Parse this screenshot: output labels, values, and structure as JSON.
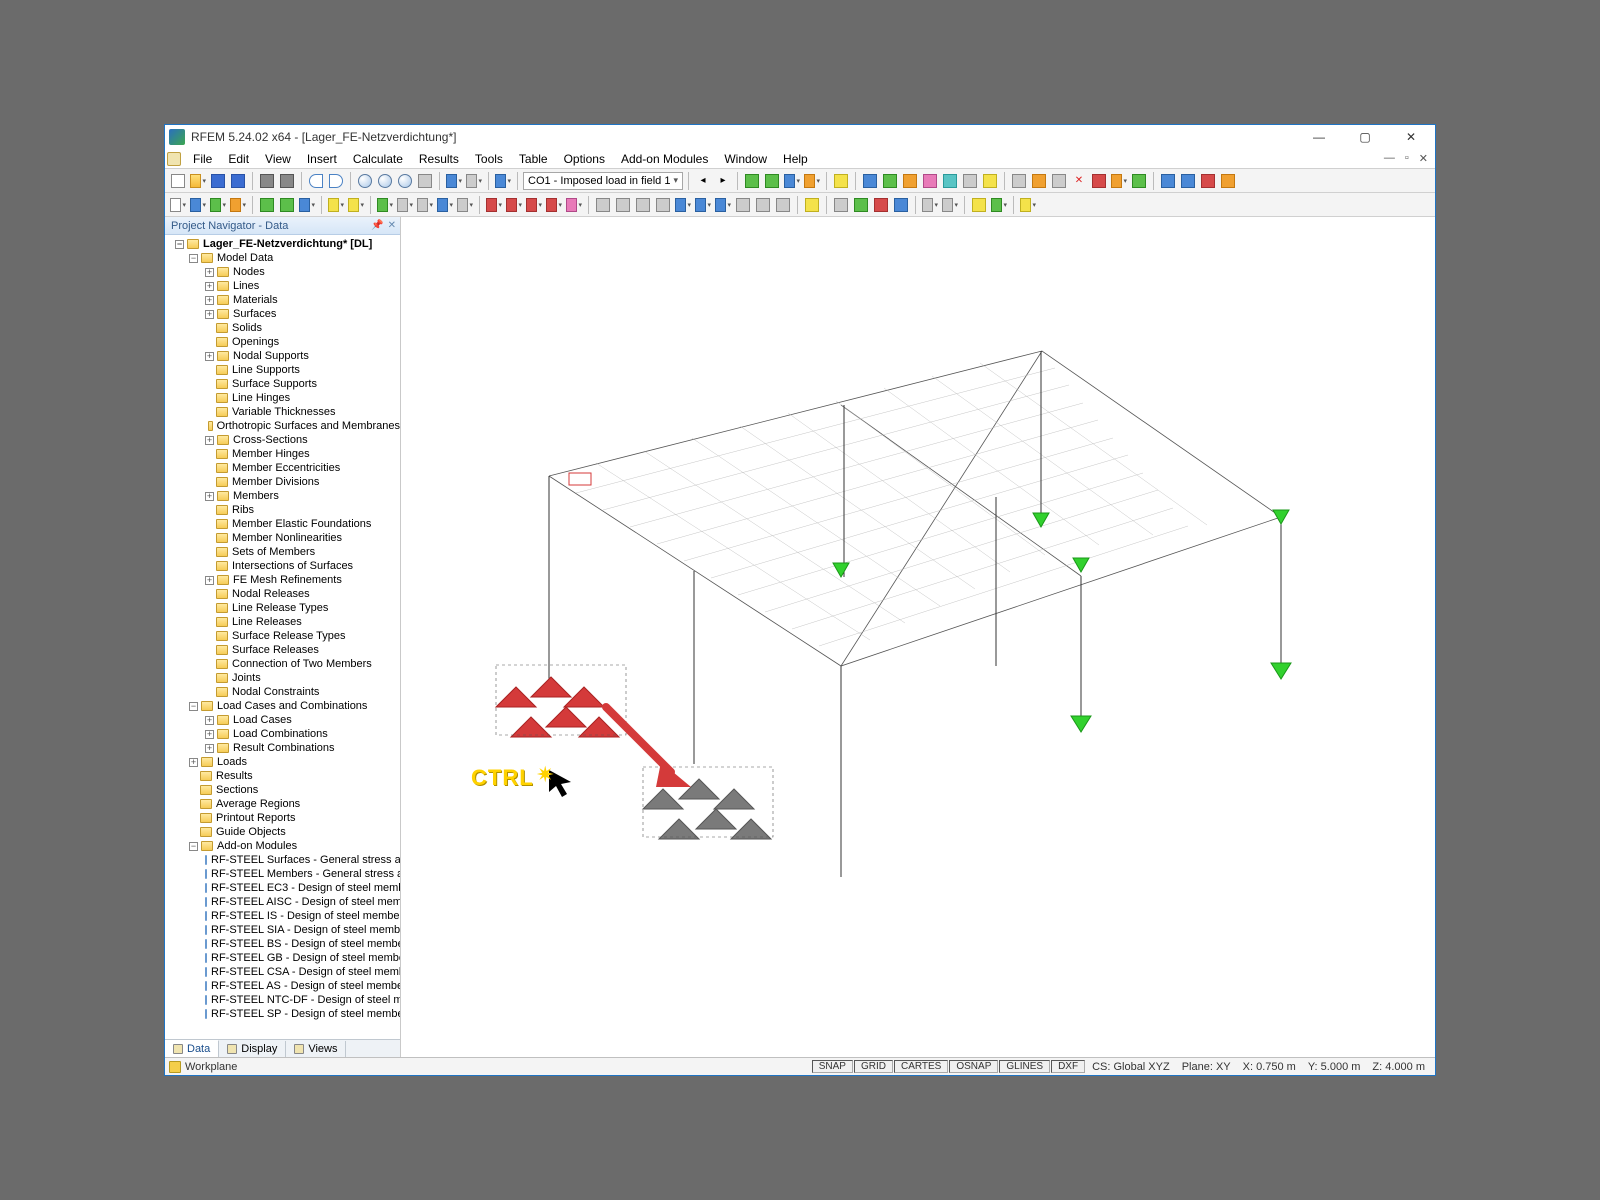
{
  "window": {
    "title": "RFEM 5.24.02 x64 - [Lager_FE-Netzverdichtung*]"
  },
  "menu": [
    "File",
    "Edit",
    "View",
    "Insert",
    "Calculate",
    "Results",
    "Tools",
    "Table",
    "Options",
    "Add-on Modules",
    "Window",
    "Help"
  ],
  "loadcase_combo": "CO1 - Imposed load in field 1",
  "navigator": {
    "title": "Project Navigator - Data",
    "root": "Lager_FE-Netzverdichtung* [DL]",
    "model_data_label": "Model Data",
    "model_items": [
      "Nodes",
      "Lines",
      "Materials",
      "Surfaces",
      "Solids",
      "Openings",
      "Nodal Supports",
      "Line Supports",
      "Surface Supports",
      "Line Hinges",
      "Variable Thicknesses",
      "Orthotropic Surfaces and Membranes",
      "Cross-Sections",
      "Member Hinges",
      "Member Eccentricities",
      "Member Divisions",
      "Members",
      "Ribs",
      "Member Elastic Foundations",
      "Member Nonlinearities",
      "Sets of Members",
      "Intersections of Surfaces",
      "FE Mesh Refinements",
      "Nodal Releases",
      "Line Release Types",
      "Line Releases",
      "Surface Release Types",
      "Surface Releases",
      "Connection of Two Members",
      "Joints",
      "Nodal Constraints"
    ],
    "loadcases_label": "Load Cases and Combinations",
    "loadcases_items": [
      "Load Cases",
      "Load Combinations",
      "Result Combinations"
    ],
    "other_items": [
      "Loads",
      "Results",
      "Sections",
      "Average Regions",
      "Printout Reports",
      "Guide Objects"
    ],
    "addon_label": "Add-on Modules",
    "addon_items": [
      "RF-STEEL Surfaces - General stress an",
      "RF-STEEL Members - General stress ai",
      "RF-STEEL EC3 - Design of steel memb",
      "RF-STEEL AISC - Design of steel mem",
      "RF-STEEL IS - Design of steel member",
      "RF-STEEL SIA - Design of steel memb",
      "RF-STEEL BS - Design of steel membe",
      "RF-STEEL GB - Design of steel membe",
      "RF-STEEL CSA - Design of steel meml",
      "RF-STEEL AS - Design of steel membe",
      "RF-STEEL NTC-DF - Design of steel m",
      "RF-STEEL SP - Design of steel membe"
    ],
    "tabs": [
      "Data",
      "Display",
      "Views"
    ]
  },
  "viewport": {
    "ctrl_label": "CTRL"
  },
  "statusbar": {
    "left": "Workplane",
    "toggles": [
      "SNAP",
      "GRID",
      "CARTES",
      "OSNAP",
      "GLINES",
      "DXF"
    ],
    "cs": "CS: Global XYZ",
    "plane": "Plane: XY",
    "x": "X: 0.750 m",
    "y": "Y: 5.000 m",
    "z": "Z: 4.000 m"
  }
}
